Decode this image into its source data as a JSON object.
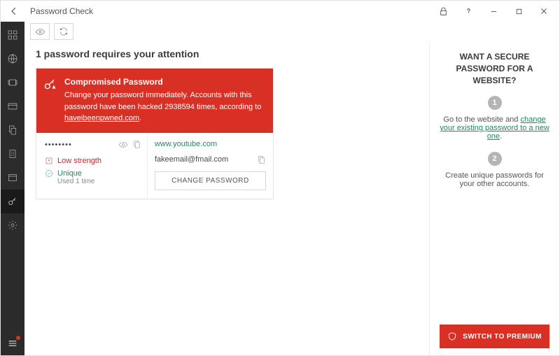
{
  "window": {
    "title": "Password Check"
  },
  "toolbar": {},
  "main": {
    "attention_title": "1 password requires your attention",
    "card": {
      "title": "Compromised Password",
      "message_a": "Change your password immediately. Accounts with this password have been hacked 2938594 times, according to ",
      "message_link": "haveibeenpwned.com",
      "message_b": ".",
      "password_mask": "••••••••",
      "strength_label": "Low strength",
      "unique_label": "Unique",
      "unique_sub": "Used 1 time",
      "site": "www.youtube.com",
      "email": "fakeemail@fmail.com",
      "change_btn": "CHANGE PASSWORD"
    }
  },
  "tips": {
    "header": "WANT A SECURE PASSWORD FOR A WEBSITE?",
    "step1_num": "1",
    "step1_a": "Go to the website and ",
    "step1_link": "change your existing password to a new one",
    "step1_b": ".",
    "step2_num": "2",
    "step2": "Create unique passwords for your other accounts."
  },
  "premium": {
    "label": "SWITCH TO PREMIUM"
  }
}
